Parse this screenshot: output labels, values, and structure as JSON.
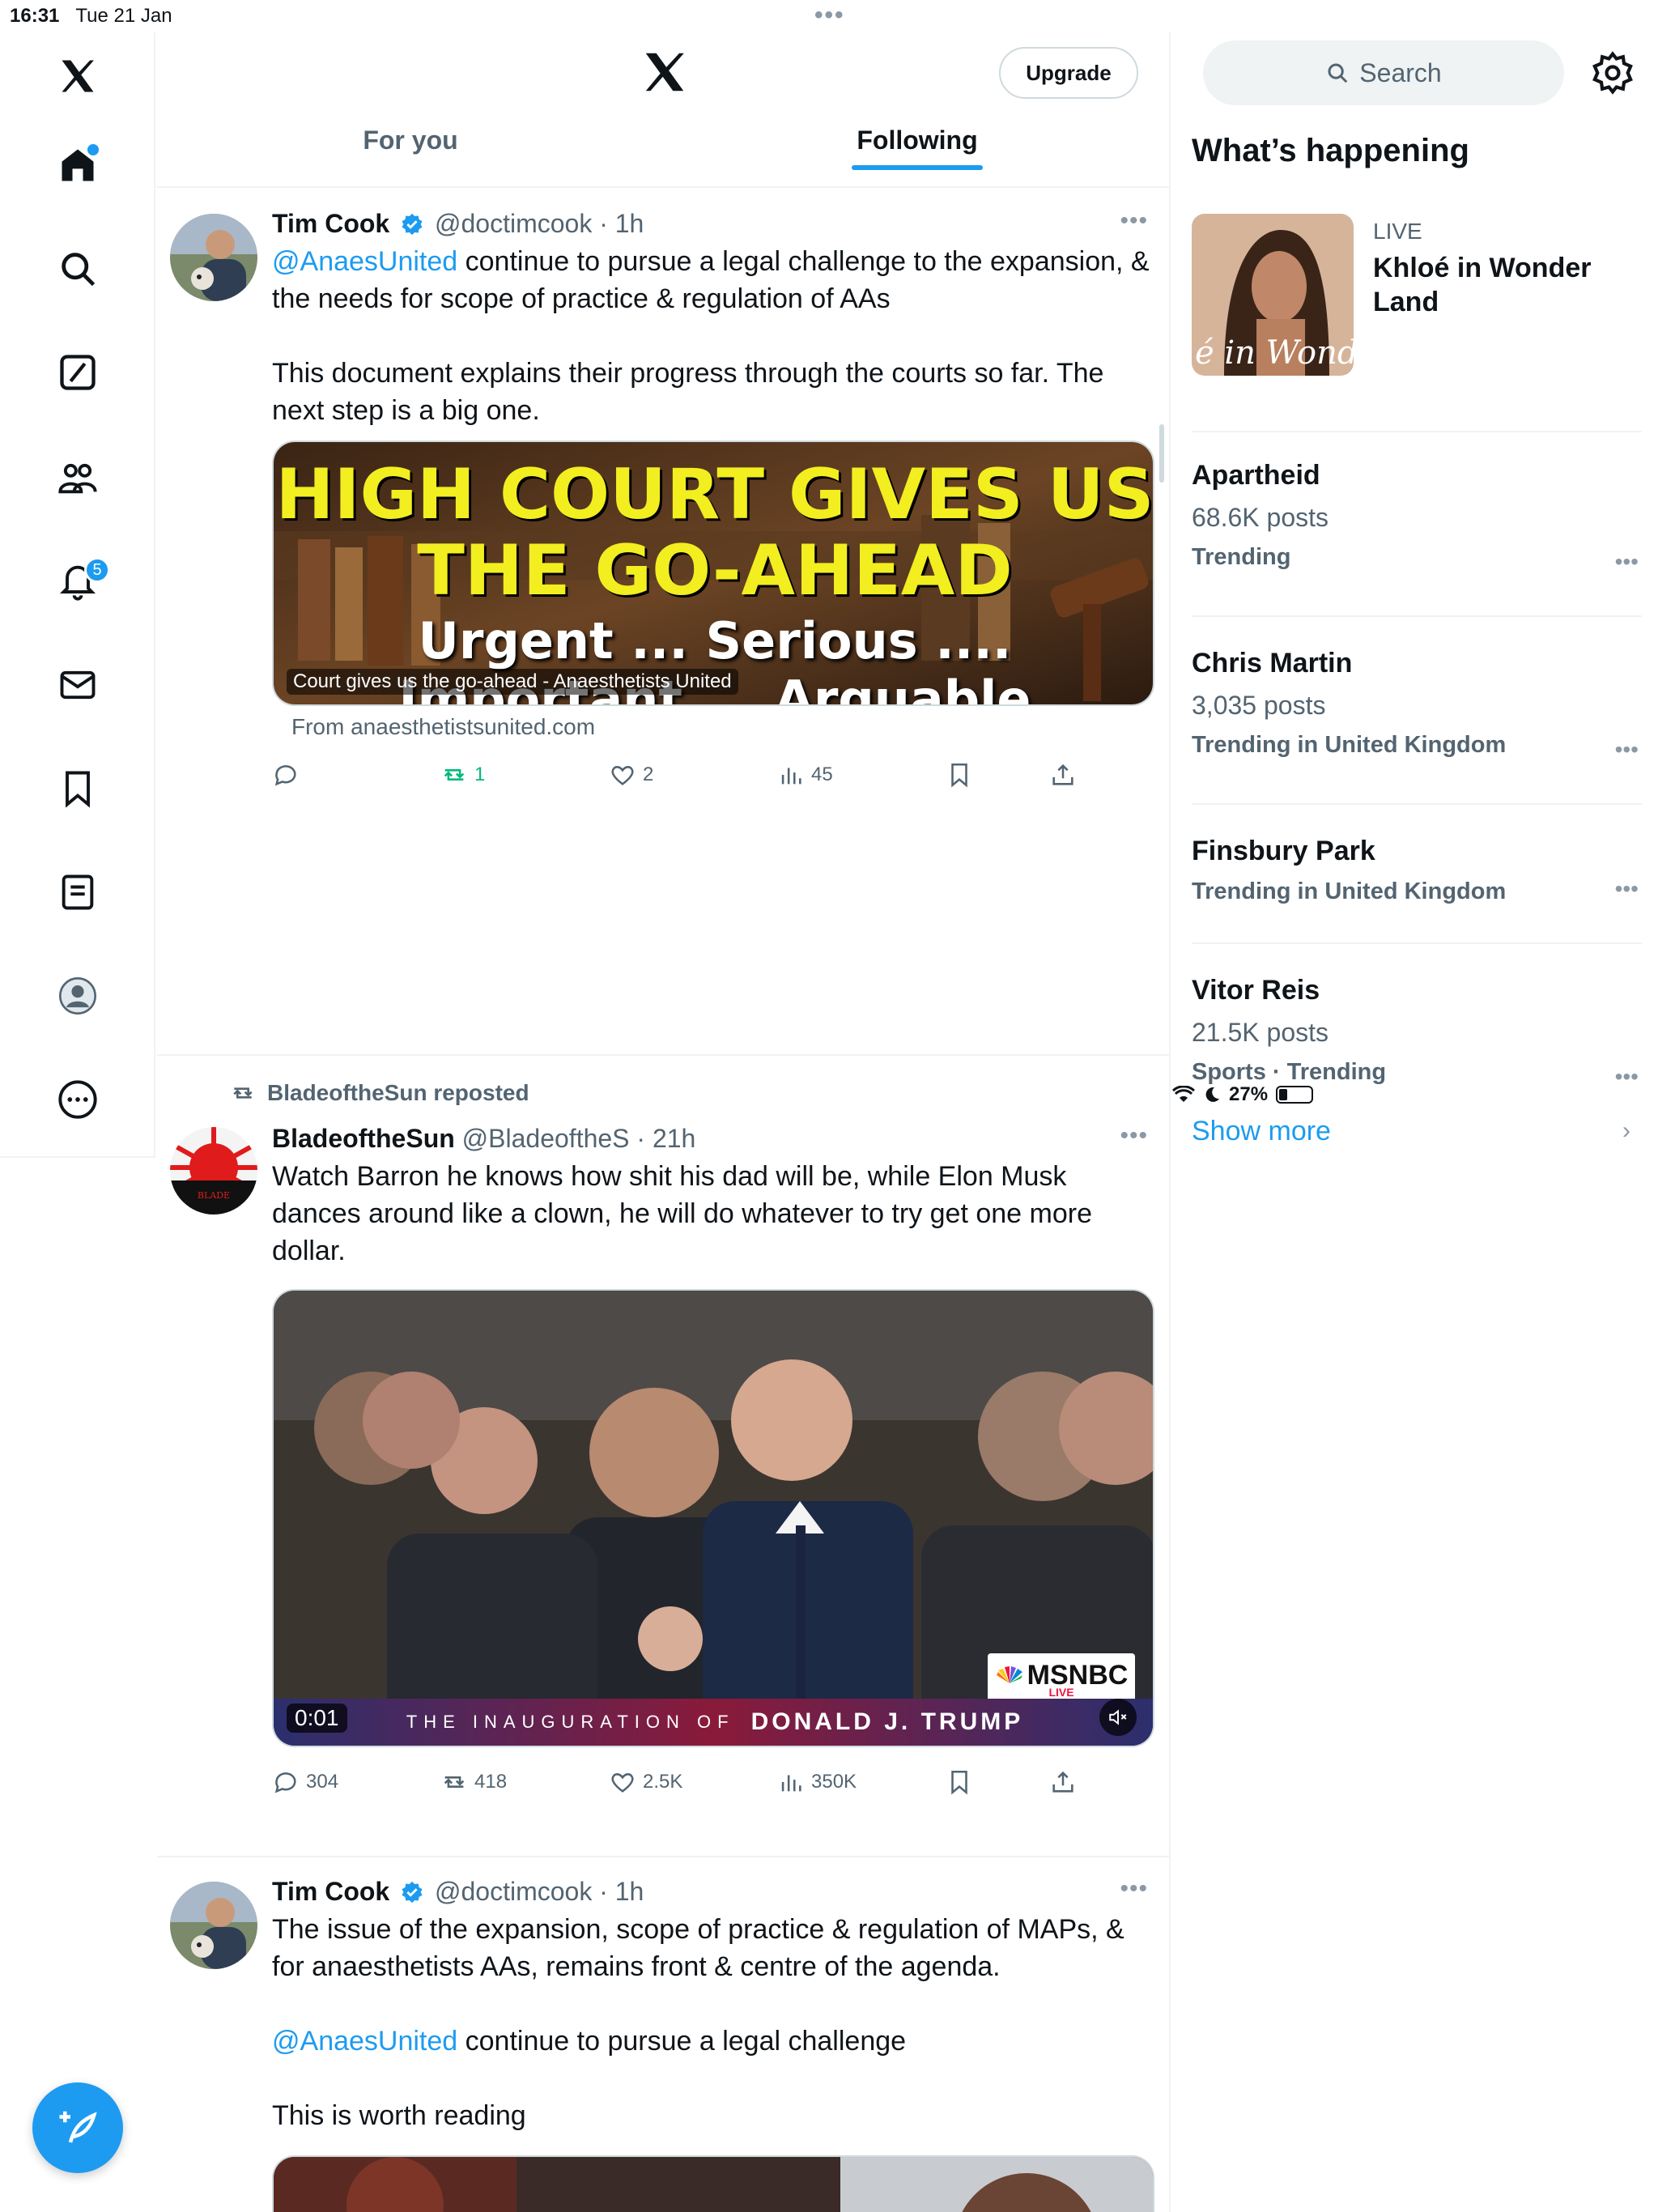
{
  "status_bar": {
    "time": "16:31",
    "date": "Tue 21 Jan",
    "battery": "27%",
    "battery_level": 0.27
  },
  "nav": {
    "notifications_badge": "5",
    "items": [
      "x-logo",
      "home-icon",
      "search-icon",
      "grok-icon",
      "communities-icon",
      "notifications-icon",
      "messages-icon",
      "bookmarks-icon",
      "lists-icon",
      "profile-icon",
      "more-icon"
    ]
  },
  "header": {
    "upgrade_label": "Upgrade",
    "tabs": [
      {
        "label": "For you",
        "active": false
      },
      {
        "label": "Following",
        "active": true
      }
    ]
  },
  "tweets": [
    {
      "name": "Tim Cook",
      "handle": "@doctimcook",
      "time": "· 1h",
      "mention": "@AnaesUnited",
      "text_1": " continue to pursue a legal challenge to the expansion, & the needs for scope of practice & regulation of AAs",
      "text_2": "This document explains their progress through the courts so far. The next step is a big one.",
      "card": {
        "headline_1": "HIGH COURT GIVES US",
        "headline_2": "THE GO-AHEAD",
        "sub_1": "Urgent ... Serious ....",
        "sub_2": "Important ... Arguable",
        "caption": "Court gives us the go-ahead - Anaesthetists United",
        "source": "From anaesthetistsunited.com"
      },
      "stats": {
        "replies": "",
        "reposts": "1",
        "likes": "2",
        "views": "45"
      }
    },
    {
      "repost_by": "BladeoftheSun reposted",
      "name": "BladeoftheSun",
      "handle": "@BladeoftheS",
      "time": "· 21h",
      "text": "Watch Barron he knows how shit his dad will be, while Elon Musk dances around like a clown, he will do whatever to try get one more dollar.",
      "video": {
        "timestamp": "0:01",
        "network": "MSNBC",
        "network_live": "LIVE",
        "banner": "THE INAUGURATION OF",
        "banner_name": "DONALD J. TRUMP"
      },
      "stats": {
        "replies": "304",
        "reposts": "418",
        "likes": "2.5K",
        "views": "350K"
      }
    },
    {
      "name": "Tim Cook",
      "handle": "@doctimcook",
      "time": "· 1h",
      "text_1": "The issue of the expansion, scope of practice & regulation of MAPs, & for anaesthetists AAs, remains front & centre of the agenda.",
      "mention": "@AnaesUnited",
      "text_2": " continue to pursue a legal challenge",
      "text_3": "This is worth reading"
    }
  ],
  "sidebar": {
    "search_placeholder": "Search",
    "heading": "What’s happening",
    "live": {
      "tag": "LIVE",
      "title": "Khloé in Wonder Land",
      "image_text": "é in Wonder L"
    },
    "trends": [
      {
        "name": "Apartheid",
        "count": "68.6K posts",
        "context": "Trending"
      },
      {
        "name": "Chris Martin",
        "count": "3,035 posts",
        "context": "Trending in United Kingdom"
      },
      {
        "name": "Finsbury Park",
        "count": "",
        "context": "Trending in United Kingdom"
      },
      {
        "name": "Vitor Reis",
        "count": "21.5K posts",
        "context": "Sports · Trending"
      }
    ],
    "show_more": "Show more"
  },
  "colors": {
    "accent": "#1d9bf0",
    "text": "#0f1419",
    "muted": "#536471",
    "repost_green": "#00ba7c",
    "border": "#eff3f4"
  }
}
